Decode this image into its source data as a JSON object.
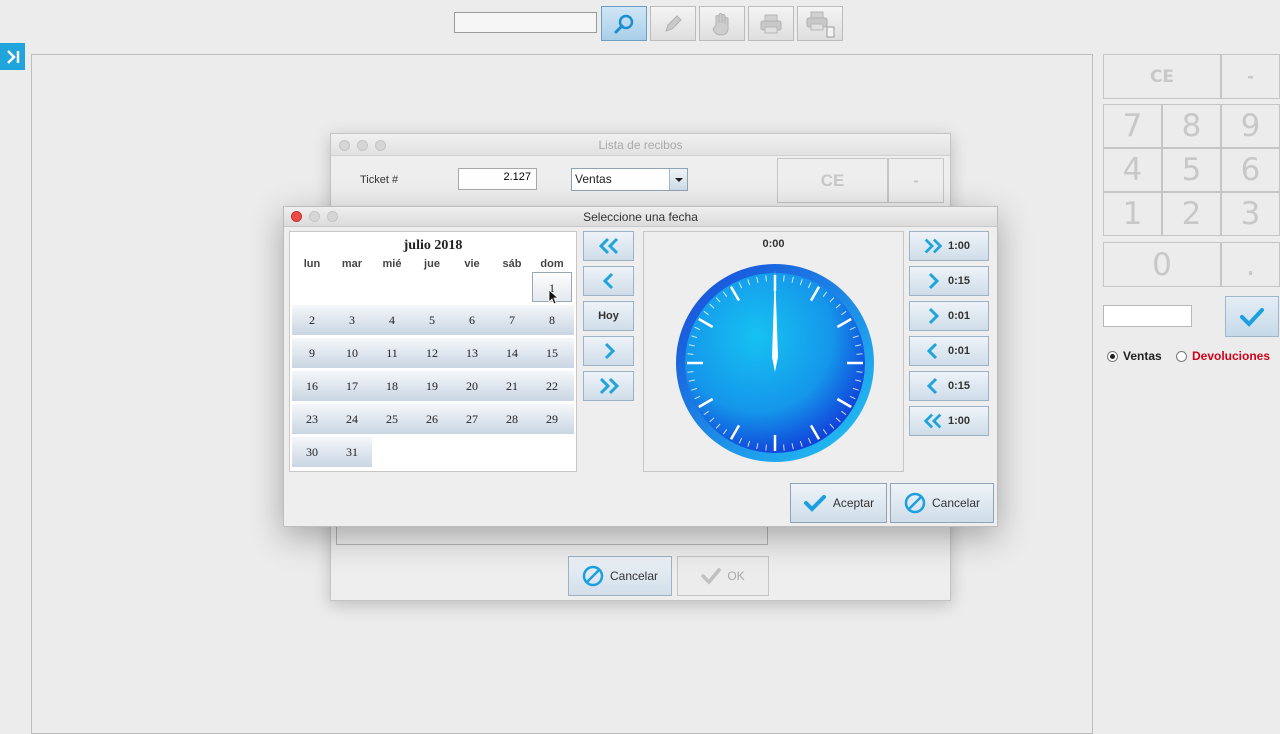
{
  "toolbar": {
    "search_value": "",
    "icons": [
      "search-icon",
      "pencil-icon",
      "hand-icon",
      "printer-icon",
      "printer-ticket-icon"
    ]
  },
  "keypad": {
    "ce": "CE",
    "minus": "-",
    "digits": [
      "7",
      "8",
      "9",
      "4",
      "5",
      "6",
      "1",
      "2",
      "3"
    ],
    "zero": "0",
    "dot": ".",
    "input_value": ""
  },
  "mode": {
    "ventas": "Ventas",
    "devoluciones": "Devoluciones",
    "selected": "Ventas"
  },
  "receipts_dialog": {
    "title": "Lista de recibos",
    "ticket_label": "Ticket #",
    "ticket_value": "2.127",
    "type_value": "Ventas",
    "ce": "CE",
    "minus": "-",
    "cancel_label": "Cancelar",
    "ok_label": "OK"
  },
  "date_dialog": {
    "title": "Seleccione una fecha",
    "month_label": "julio 2018",
    "weekdays": [
      "lun",
      "mar",
      "mié",
      "jue",
      "vie",
      "sáb",
      "dom"
    ],
    "weeks": [
      [
        "",
        "",
        "",
        "",
        "",
        "",
        "1"
      ],
      [
        "2",
        "3",
        "4",
        "5",
        "6",
        "7",
        "8"
      ],
      [
        "9",
        "10",
        "11",
        "12",
        "13",
        "14",
        "15"
      ],
      [
        "16",
        "17",
        "18",
        "19",
        "20",
        "21",
        "22"
      ],
      [
        "23",
        "24",
        "25",
        "26",
        "27",
        "28",
        "29"
      ],
      [
        "30",
        "31",
        "",
        "",
        "",
        "",
        ""
      ]
    ],
    "selected_day": "1",
    "today_label": "Hoy",
    "time_value": "0:00",
    "time_buttons": [
      "1:00",
      "0:15",
      "0:01",
      "0:01",
      "0:15",
      "1:00"
    ],
    "accept_label": "Aceptar",
    "cancel_label": "Cancelar"
  },
  "colors": {
    "accent": "#1fa5dc",
    "clock_face": "#1a6ee6",
    "red_text": "#d0021b"
  }
}
